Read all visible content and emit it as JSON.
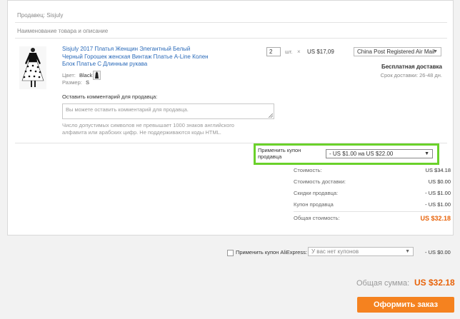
{
  "seller_label": "Продавец: Sisjuly",
  "item_header": "Наименование товара и описание",
  "product": {
    "title_lines": [
      "Sisjuly 2017 Платья Женщин Элегантный Белый",
      "Черный Горошек женская Винтаж Платье A-Line Колен",
      "Блок Платье С Длинным рукава"
    ],
    "color_label": "Цвет:",
    "color_value": "Black",
    "size_label": "Размер:",
    "size_value": "S",
    "quantity": "2",
    "unit": "шт.",
    "times": "×",
    "price": "US $17,09",
    "shipping_method": "China Post Registered Air Mail",
    "free_shipping": "Бесплатная доставка",
    "delivery_time": "Срок доставки: 26-48 дн."
  },
  "comment": {
    "label": "Оставить комментарий для продавца:",
    "placeholder": "Вы можете оставить комментарий для продавца.",
    "hint_lines": [
      "Число допустимых символов не превышает 1000 знаков английского",
      "алфавита или арабских цифр. Не поддерживаются коды HTML."
    ]
  },
  "seller_coupon": {
    "label_lines": [
      "Применить купон",
      "продавца"
    ],
    "selected": "- US $1.00 на US $22.00"
  },
  "summary": [
    {
      "label": "Стоимость:",
      "value": "US $34.18"
    },
    {
      "label": "Стоимость доставки:",
      "value": "US $0.00"
    },
    {
      "label": "Скидки продавца:",
      "value": "- US $1.00"
    },
    {
      "label": "Купон продавца",
      "value": "- US $1.00"
    }
  ],
  "total": {
    "label": "Общая стоимость:",
    "value": "US $32.18"
  },
  "aliexpress_coupon": {
    "label": "Применить купон AliExpress:",
    "selected": "У вас нет купонов",
    "value": "- US $0.00"
  },
  "grand_total": {
    "label": "Общая сумма:",
    "value": "US $32.18"
  },
  "checkout_button": "Оформить заказ",
  "colors": {
    "accent": "#f5821f",
    "highlight": "#6ad12a",
    "total_text": "#e8630a"
  }
}
